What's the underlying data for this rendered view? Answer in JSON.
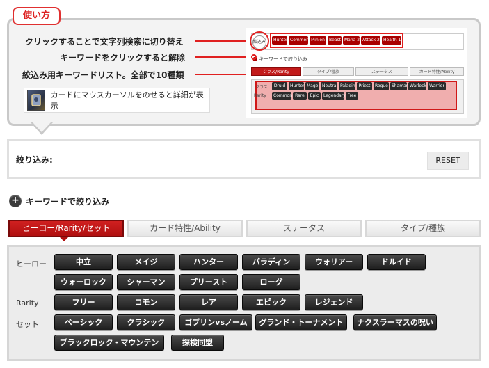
{
  "help": {
    "tab_label": "使い方",
    "line1": "クリックすることで文字列検索に切り替え",
    "line2": "キーワードをクリックすると解除",
    "line3": "絞込み用キーワードリスト。全部で10種類",
    "card_hint": "カードにマウスカーソルをのせると詳細が表示",
    "preview": {
      "label": "絞込み",
      "chips": [
        "Hunter",
        "Common",
        "Minion",
        "Beast",
        "Mana 2",
        "Attack 2",
        "Health 1"
      ],
      "toggle_text": "キーワードで絞り込み",
      "tabs": [
        "クラス/Rarity",
        "タイプ/種族",
        "ステータス",
        "カード特性/Ability"
      ],
      "row_labels": [
        "クラス",
        "Rarity"
      ],
      "class_chips": [
        "Druid",
        "Hunter",
        "Mage",
        "Neutral",
        "Paladin",
        "Priest",
        "Rogue",
        "Shaman",
        "Warlock",
        "Warrior"
      ],
      "rarity_chips": [
        "Common",
        "Rare",
        "Epic",
        "Legendary",
        "Free"
      ]
    }
  },
  "filter": {
    "label": "絞り込み:",
    "reset_label": "RESET"
  },
  "keyword_toggle": {
    "icon": "plus-icon",
    "label": "キーワードで絞り込み"
  },
  "tabs": [
    {
      "label": "ヒーロー/Rarity/セット",
      "active": true
    },
    {
      "label": "カード特性/Ability",
      "active": false
    },
    {
      "label": "ステータス",
      "active": false
    },
    {
      "label": "タイプ/種族",
      "active": false
    }
  ],
  "rows": {
    "hero": {
      "label": "ヒーロー",
      "buttons": [
        "中立",
        "メイジ",
        "ハンター",
        "パラディン",
        "ウォリアー",
        "ドルイド",
        "ウォーロック",
        "シャーマン",
        "プリースト",
        "ローグ"
      ]
    },
    "rarity": {
      "label": "Rarity",
      "buttons": [
        "フリー",
        "コモン",
        "レア",
        "エピック",
        "レジェンド"
      ]
    },
    "set": {
      "label": "セット",
      "buttons": [
        "ベーシック",
        "クラシック",
        "ゴブリンvsノーム",
        "グランド・トーナメント",
        "ナクスラーマスの呪い",
        "ブラックロック・マウンテン",
        "探検同盟"
      ]
    }
  },
  "colors": {
    "accent_red": "#c21a1a",
    "button_dark": "#2a2a2a",
    "panel_bg": "#ececec"
  }
}
